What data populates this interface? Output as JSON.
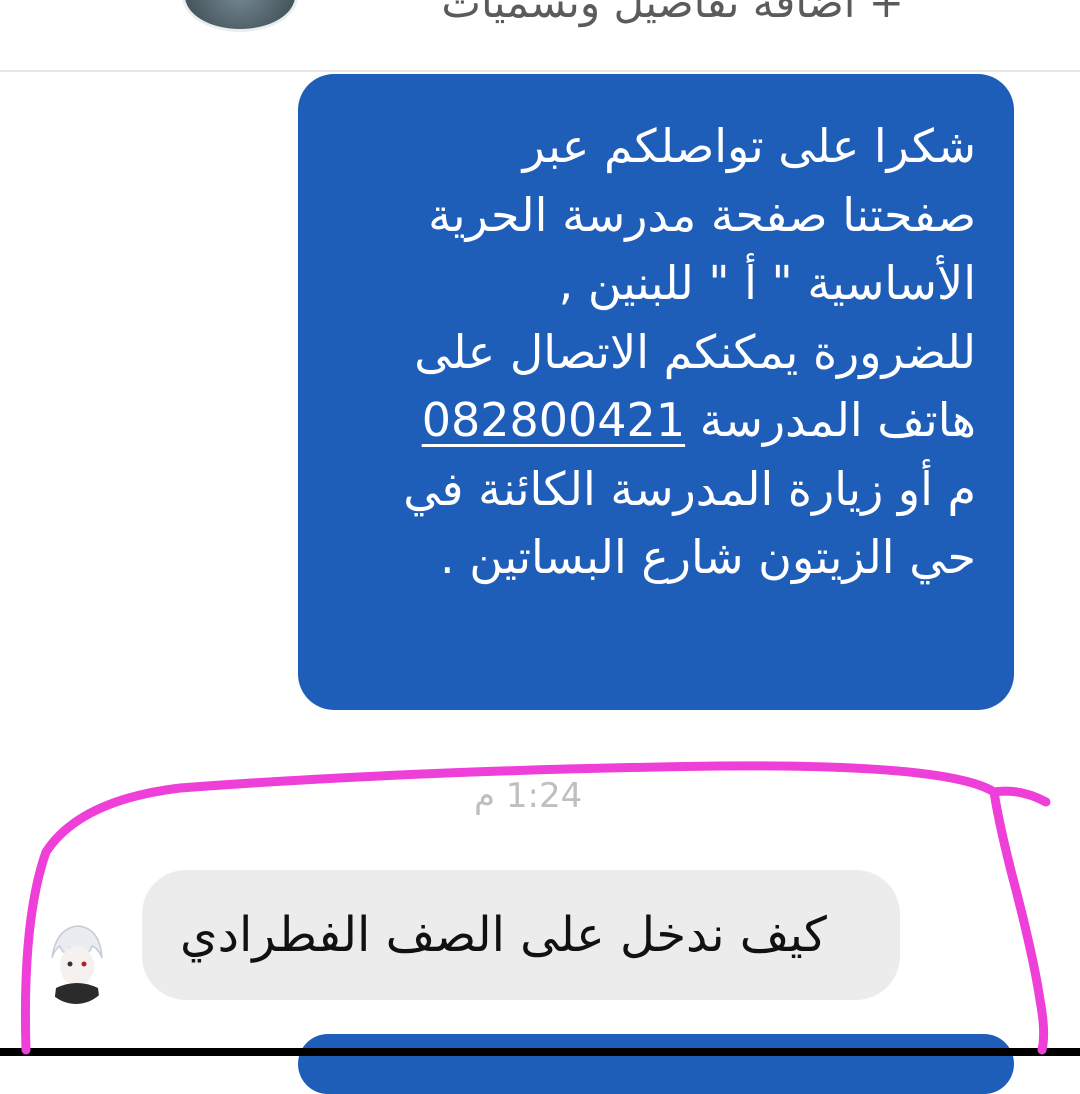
{
  "header": {
    "add_details_label": "+ اضافة تفاصيل وتسميات"
  },
  "messages": {
    "outgoing_lines": [
      "شكرا على تواصلكم عبر",
      "صفحتنا صفحة مدرسة الحرية",
      "الأساسية \" أ \" للبنين ,",
      "للضرورة يمكنكم الاتصال على",
      "هاتف المدرسة",
      "م أو زيارة المدرسة الكائنة في",
      "حي الزيتون شارع البساتين ."
    ],
    "phone_number": "082800421",
    "timestamp": "1:24 م",
    "incoming_text": "كيف ندخل على الصف الفطرادي"
  },
  "colors": {
    "outgoing_bubble": "#1f5eb8",
    "incoming_bubble": "#ececec",
    "annotation_stroke": "#ee3fd8"
  },
  "icons": {
    "contact_avatar": "profile-photo",
    "sender_avatar": "anime-character-avatar"
  }
}
